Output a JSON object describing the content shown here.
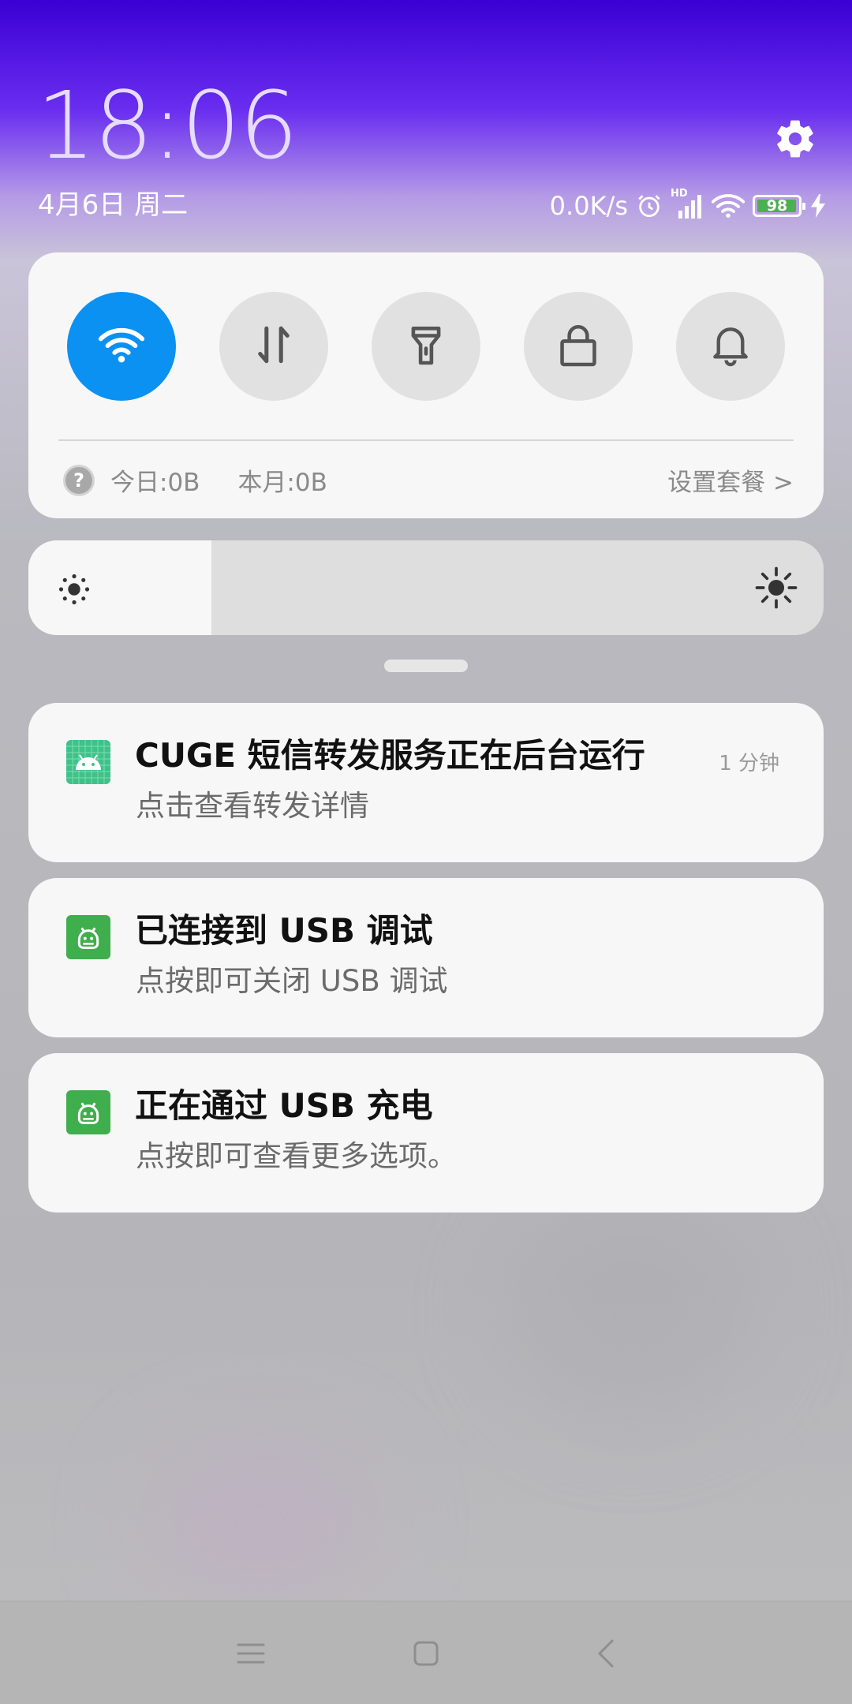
{
  "header": {
    "time": "18:06",
    "date": "4月6日 周二",
    "settings_icon": "gear-icon"
  },
  "status_bar": {
    "net_speed": "0.0K/s",
    "signal_badge": "HD",
    "battery_level": "98",
    "battery_fraction": 0.98,
    "charging_icon": "bolt-icon"
  },
  "quick_settings": {
    "tiles": [
      {
        "id": "wifi",
        "icon": "wifi-icon",
        "active": true
      },
      {
        "id": "mobile-data",
        "icon": "data-arrows-icon",
        "active": false
      },
      {
        "id": "flashlight",
        "icon": "flashlight-icon",
        "active": false
      },
      {
        "id": "rotation-lock",
        "icon": "lock-icon",
        "active": false
      },
      {
        "id": "sound",
        "icon": "bell-icon",
        "active": false
      }
    ],
    "data_usage": {
      "help_symbol": "?",
      "today": "今日:0B",
      "month": "本月:0B",
      "plan_link": "设置套餐 >"
    },
    "accent_color": "#0a91f2"
  },
  "brightness": {
    "level": 0.23,
    "low_icon": "brightness-low-icon",
    "high_icon": "brightness-high-icon"
  },
  "notifications": [
    {
      "title": "CUGE 短信转发服务正在后台运行",
      "body": "点击查看转发详情",
      "time": "1 分钟",
      "icon": "android-app-icon"
    },
    {
      "title": "已连接到 USB 调试",
      "body": "点按即可关闭 USB 调试",
      "icon": "android-debug-icon"
    },
    {
      "title": "正在通过 USB 充电",
      "body": "点按即可查看更多选项。",
      "icon": "android-debug-icon"
    }
  ],
  "nav_bar": {
    "buttons": [
      "menu-icon",
      "home-icon",
      "back-icon"
    ]
  }
}
